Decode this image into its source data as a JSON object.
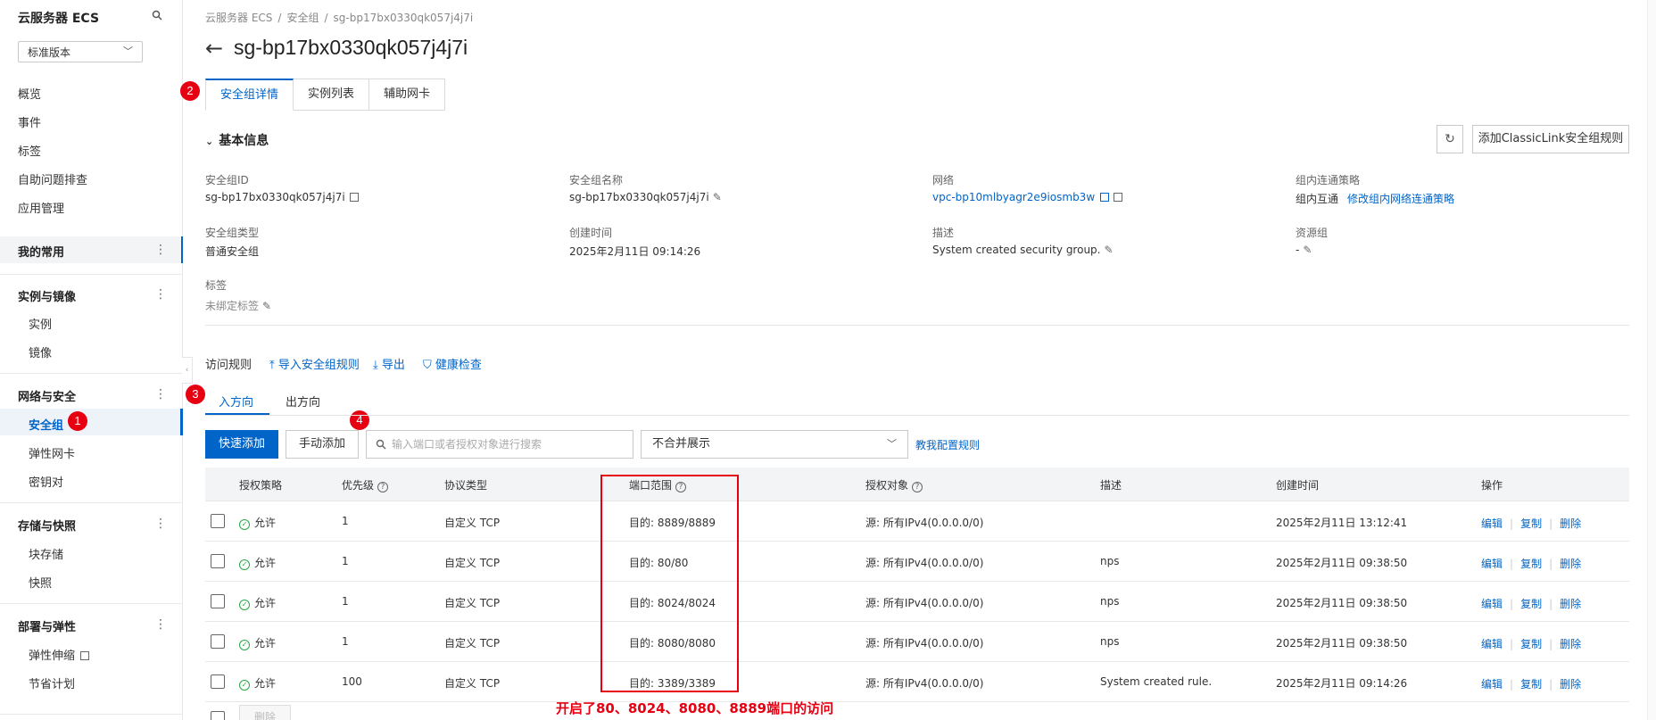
{
  "sidebar": {
    "title": "云服务器 ECS",
    "version_select": "标准版本",
    "top_items": [
      "概览",
      "事件",
      "标签",
      "自助问题排查",
      "应用管理"
    ],
    "my_common": "我的常用",
    "groups": [
      {
        "name": "实例与镜像",
        "items": [
          "实例",
          "镜像"
        ]
      },
      {
        "name": "网络与安全",
        "items": [
          "安全组",
          "弹性网卡",
          "密钥对"
        ]
      },
      {
        "name": "存储与快照",
        "items": [
          "块存储",
          "快照"
        ]
      },
      {
        "name": "部署与弹性",
        "items": [
          "弹性伸缩",
          "节省计划"
        ]
      }
    ]
  },
  "badges": [
    "1",
    "2",
    "3",
    "4"
  ],
  "breadcrumb": [
    "云服务器 ECS",
    "安全组",
    "sg-bp17bx0330qk057j4j7i"
  ],
  "page_title": "sg-bp17bx0330qk057j4j7i",
  "tabs": [
    "安全组详情",
    "实例列表",
    "辅助网卡"
  ],
  "basic_info": {
    "section_title": "基本信息",
    "add_classic_link": "添加ClassicLink安全组规则",
    "fields": {
      "sg_id_label": "安全组ID",
      "sg_id": "sg-bp17bx0330qk057j4j7i",
      "sg_name_label": "安全组名称",
      "sg_name": "sg-bp17bx0330qk057j4j7i",
      "network_label": "网络",
      "network": "vpc-bp10mlbyagr2e9iosmb3w",
      "intra_policy_label": "组内连通策略",
      "intra_policy": "组内互通",
      "intra_policy_link": "修改组内网络连通策略",
      "sg_type_label": "安全组类型",
      "sg_type": "普通安全组",
      "created_label": "创建时间",
      "created": "2025年2月11日 09:14:26",
      "desc_label": "描述",
      "desc": "System created security group.",
      "resource_group_label": "资源组",
      "resource_group": "-",
      "tags_label": "标签",
      "tags": "未绑定标签"
    }
  },
  "rules": {
    "label": "访问规则",
    "import_link": "导入安全组规则",
    "export_link": "导出",
    "health_link": "健康检查",
    "directions": [
      "入方向",
      "出方向"
    ],
    "quick_add": "快速添加",
    "manual_add": "手动添加",
    "search_placeholder": "输入端口或者授权对象进行搜索",
    "merge_select": "不合并展示",
    "teach_link": "教我配置规则",
    "columns": [
      "授权策略",
      "优先级",
      "协议类型",
      "端口范围",
      "授权对象",
      "描述",
      "创建时间",
      "操作"
    ],
    "rows": [
      {
        "policy": "允许",
        "priority": "1",
        "protocol": "自定义 TCP",
        "port": "目的: 8889/8889",
        "source": "源: 所有IPv4(0.0.0.0/0)",
        "desc": "",
        "created": "2025年2月11日 13:12:41"
      },
      {
        "policy": "允许",
        "priority": "1",
        "protocol": "自定义 TCP",
        "port": "目的: 80/80",
        "source": "源: 所有IPv4(0.0.0.0/0)",
        "desc": "nps",
        "created": "2025年2月11日 09:38:50"
      },
      {
        "policy": "允许",
        "priority": "1",
        "protocol": "自定义 TCP",
        "port": "目的: 8024/8024",
        "source": "源: 所有IPv4(0.0.0.0/0)",
        "desc": "nps",
        "created": "2025年2月11日 09:38:50"
      },
      {
        "policy": "允许",
        "priority": "1",
        "protocol": "自定义 TCP",
        "port": "目的: 8080/8080",
        "source": "源: 所有IPv4(0.0.0.0/0)",
        "desc": "nps",
        "created": "2025年2月11日 09:38:50"
      },
      {
        "policy": "允许",
        "priority": "100",
        "protocol": "自定义 TCP",
        "port": "目的: 3389/3389",
        "source": "源: 所有IPv4(0.0.0.0/0)",
        "desc": "System created rule.",
        "created": "2025年2月11日 09:14:26"
      }
    ],
    "actions": [
      "编辑",
      "复制",
      "删除"
    ],
    "bulk_delete": "删除"
  },
  "annotation_note": "开启了80、8024、8080、8889端口的访问",
  "colors": {
    "accent": "#0064c8",
    "annotation": "#e60012",
    "allow": "#27a844"
  }
}
